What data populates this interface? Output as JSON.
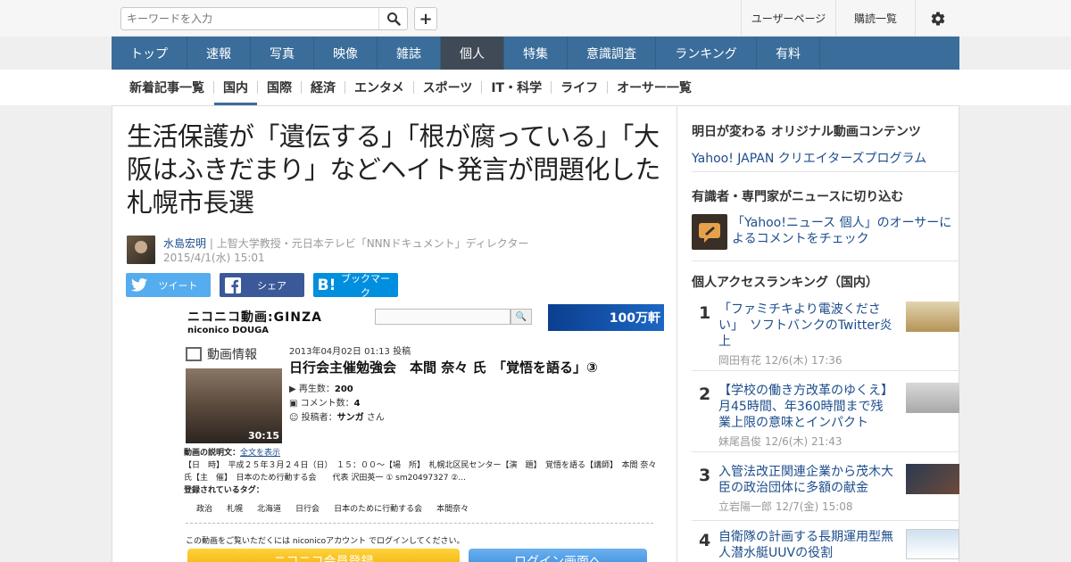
{
  "header": {
    "search_placeholder": "キーワードを入力",
    "user_page_label": "ユーザーページ",
    "subscriptions_label": "購読一覧"
  },
  "nav": {
    "items": [
      {
        "label": "トップ"
      },
      {
        "label": "速報"
      },
      {
        "label": "写真"
      },
      {
        "label": "映像"
      },
      {
        "label": "雑誌"
      },
      {
        "label": "個人"
      },
      {
        "label": "特集"
      },
      {
        "label": "意識調査"
      },
      {
        "label": "ランキング"
      },
      {
        "label": "有料"
      }
    ],
    "active": "個人"
  },
  "subnav": {
    "items": [
      {
        "label": "新着記事一覧"
      },
      {
        "label": "国内"
      },
      {
        "label": "国際"
      },
      {
        "label": "経済"
      },
      {
        "label": "エンタメ"
      },
      {
        "label": "スポーツ"
      },
      {
        "label": "IT・科学"
      },
      {
        "label": "ライフ"
      },
      {
        "label": "オーサー一覧"
      }
    ],
    "active": "国内"
  },
  "article": {
    "title": "生活保護が「遺伝する」「根が腐っている」「大阪はふきだまり」などヘイト発言が問題化した札幌市長選",
    "author_name": "水島宏明",
    "author_profile": "| 上智大学教授・元日本テレビ「NNNドキュメント」ディレクター",
    "date": "2015/4/1(水) 15:01",
    "share": {
      "twitter": "ツイート",
      "facebook": "シェア",
      "hatena": "ブックマーク"
    }
  },
  "embed": {
    "logo_line1": "ニコニコ動画:GINZA",
    "logo_line2": "niconico DOUGA",
    "banner_text": "100万軒",
    "section_label": "動画情報",
    "posted": "2013年04月02日 01:13 投稿",
    "title": "日行会主催勉強会　本間 奈々 氏　「覚悟を語る」③",
    "duration": "30:15",
    "stats": {
      "views_label": "再生数：",
      "views": "200",
      "comments_label": "コメント数：",
      "comments": "4",
      "poster_label": "投稿者：",
      "poster": "サンガ",
      "poster_suffix": "さん"
    },
    "desc_label": "動画の説明文：",
    "desc_link": "全文を表示",
    "desc_text": "【日　時】　平成２５年３月２４日（日）　１５：００〜【場　所】　札幌北区民センター【演　題】　覚悟を語る【講師】　本間 奈々 氏【主　催】　日本のため行動する会　　代表 沢田英一 ① sm20497327 ②...",
    "tags_label": "登録されているタグ：",
    "tags": [
      "政治",
      "札幌",
      "北海道",
      "日行会",
      "日本のために行動する会",
      "本間奈々"
    ],
    "login_text": "この動画をご覧いただくには niconicoアカウント でログインしてください。",
    "register_button": "ニコニコ会員登録",
    "login_button": "ログイン画面へ"
  },
  "sidebar": {
    "original_heading": "明日が変わる オリジナル動画コンテンツ",
    "original_link": "Yahoo! JAPAN クリエイターズプログラム",
    "expert_heading": "有識者・専門家がニュースに切り込む",
    "expert_link": "「Yahoo!ニュース 個人」のオーサーによるコメントをチェック",
    "ranking_heading": "個人アクセスランキング（国内）",
    "ranking": [
      {
        "rank": "1",
        "title": "「ファミチキより電波ください」　ソフトバンクのTwitter炎上",
        "meta": "岡田有花 12/6(木) 17:36"
      },
      {
        "rank": "2",
        "title": "【学校の働き方改革のゆくえ】月45時間、年360時間まで残業上限の意味とインパクト",
        "meta": "妹尾昌俊 12/6(木) 21:43"
      },
      {
        "rank": "3",
        "title": "入管法改正関連企業から茂木大臣の政治団体に多額の献金",
        "meta": "立岩陽一郎 12/7(金) 15:08"
      },
      {
        "rank": "4",
        "title": "自衛隊の計画する長期運用型無人潜水艇UUVの役割",
        "meta": ""
      }
    ]
  },
  "colors": {
    "nav_bg": "#3b6d9a",
    "nav_active": "#404a56",
    "link": "#1c4d8c",
    "twitter": "#55acee",
    "facebook": "#3b5998",
    "hatena": "#008fde"
  }
}
